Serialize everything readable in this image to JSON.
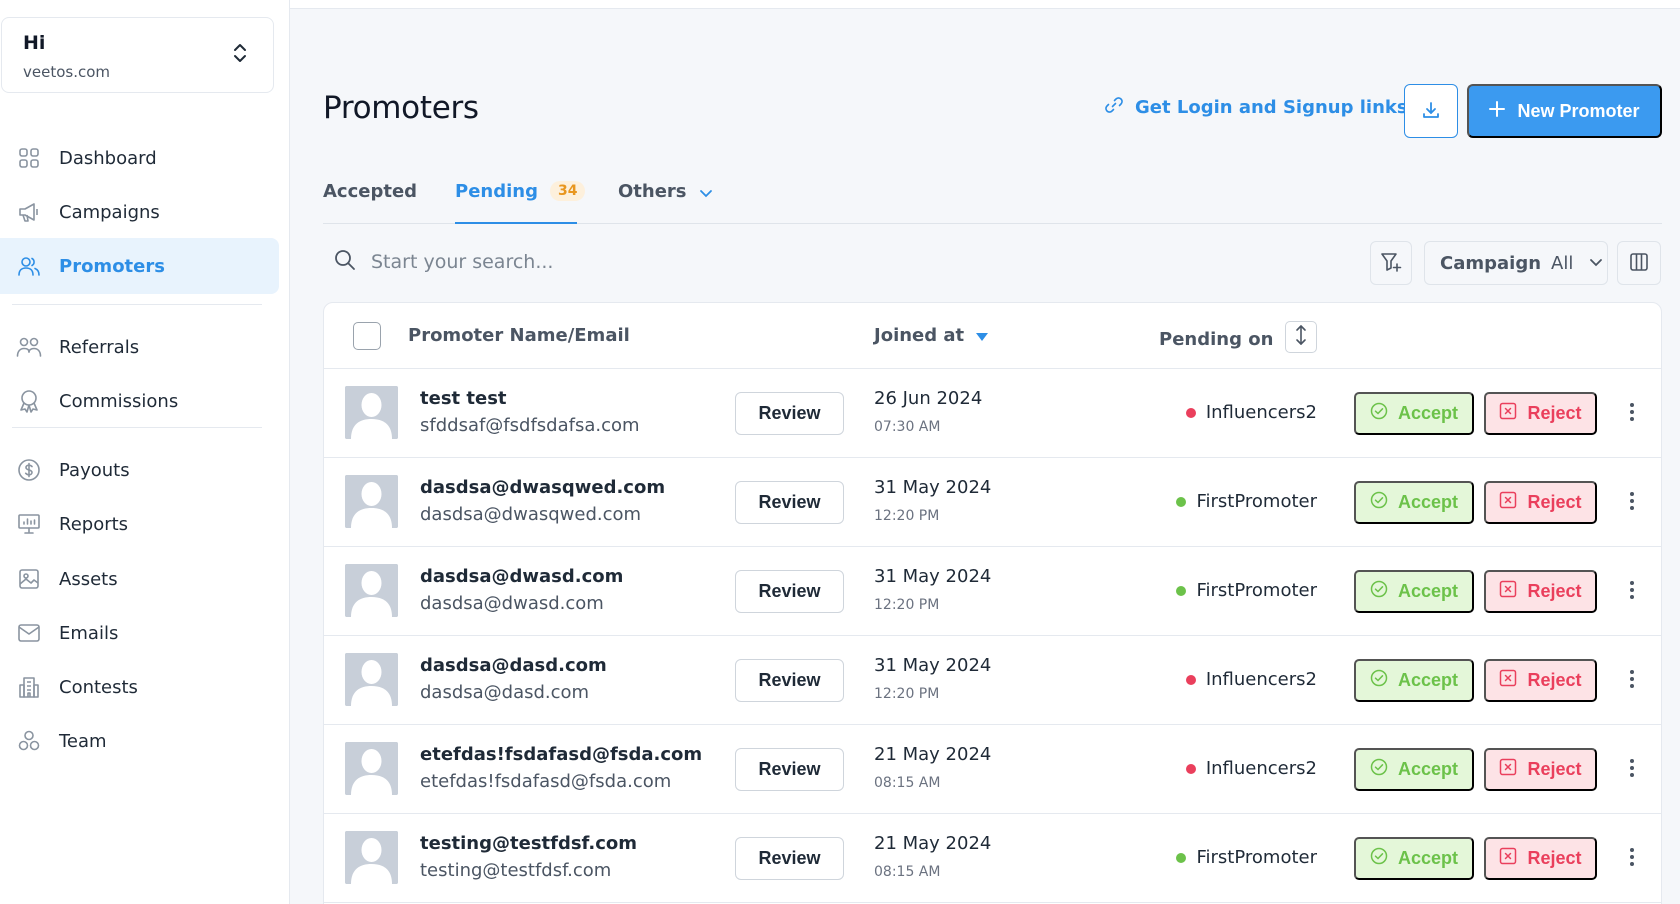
{
  "org": {
    "name": "Hi",
    "domain": "veetos.com"
  },
  "nav": [
    {
      "label": "Dashboard",
      "icon": "dashboard-icon",
      "active": false
    },
    {
      "label": "Campaigns",
      "icon": "megaphone-icon",
      "active": false
    },
    {
      "label": "Promoters",
      "icon": "users-icon",
      "active": true
    },
    {
      "label": "Referrals",
      "icon": "referrals-icon",
      "active": false
    },
    {
      "label": "Commissions",
      "icon": "award-icon",
      "active": false
    },
    {
      "label": "Payouts",
      "icon": "dollar-icon",
      "active": false
    },
    {
      "label": "Reports",
      "icon": "reports-icon",
      "active": false
    },
    {
      "label": "Assets",
      "icon": "image-icon",
      "active": false
    },
    {
      "label": "Emails",
      "icon": "mail-icon",
      "active": false
    },
    {
      "label": "Contests",
      "icon": "building-icon",
      "active": false
    },
    {
      "label": "Team",
      "icon": "team-icon",
      "active": false
    }
  ],
  "header": {
    "title": "Promoters",
    "links_label": "Get Login and Signup links",
    "new_label": "New Promoter"
  },
  "tabs": {
    "accepted": "Accepted",
    "pending": "Pending",
    "pending_count": "34",
    "others": "Others"
  },
  "search": {
    "placeholder": "Start your search..."
  },
  "campaign_filter": {
    "label": "Campaign",
    "value": "All"
  },
  "table": {
    "col_name": "Promoter Name/Email",
    "col_joined": "Joined at",
    "col_pending": "Pending on",
    "review_label": "Review",
    "accept_label": "Accept",
    "reject_label": "Reject",
    "rows": [
      {
        "name": "test test",
        "email": "sfddsaf@fsdfsdafsa.com",
        "date": "26 Jun 2024",
        "time": "07:30 AM",
        "campaign": "Influencers2",
        "campaign_color": "#ea3f5c"
      },
      {
        "name": "dasdsa@dwasqwed.com",
        "email": "dasdsa@dwasqwed.com",
        "date": "31 May 2024",
        "time": "12:20 PM",
        "campaign": "FirstPromoter",
        "campaign_color": "#6cc24a"
      },
      {
        "name": "dasdsa@dwasd.com",
        "email": "dasdsa@dwasd.com",
        "date": "31 May 2024",
        "time": "12:20 PM",
        "campaign": "FirstPromoter",
        "campaign_color": "#6cc24a"
      },
      {
        "name": "dasdsa@dasd.com",
        "email": "dasdsa@dasd.com",
        "date": "31 May 2024",
        "time": "12:20 PM",
        "campaign": "Influencers2",
        "campaign_color": "#ea3f5c"
      },
      {
        "name": "etefdas!fsdafasd@fsda.com",
        "email": "etefdas!fsdafasd@fsda.com",
        "date": "21 May 2024",
        "time": "08:15 AM",
        "campaign": "Influencers2",
        "campaign_color": "#ea3f5c"
      },
      {
        "name": "testing@testfdsf.com",
        "email": "testing@testfdsf.com",
        "date": "21 May 2024",
        "time": "08:15 AM",
        "campaign": "FirstPromoter",
        "campaign_color": "#6cc24a"
      }
    ]
  },
  "colors": {
    "accent": "#2d8ee6",
    "primary_button": "#3b9af0",
    "accept": "#6cc24a",
    "reject": "#ea3f5c",
    "badge": "#e8961f"
  }
}
